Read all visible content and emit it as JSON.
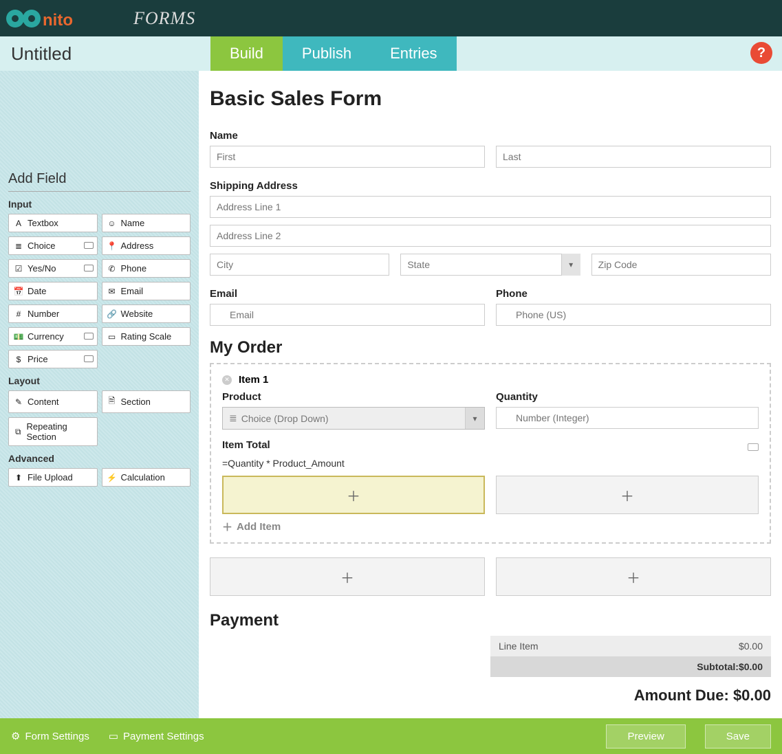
{
  "header": {
    "brand_text": "FORMS"
  },
  "nav": {
    "form_name": "Untitled",
    "tabs": {
      "build": "Build",
      "publish": "Publish",
      "entries": "Entries"
    },
    "help": "?"
  },
  "sidebar": {
    "title": "Add Field",
    "groups": {
      "input": {
        "label": "Input",
        "items": [
          {
            "label": "Textbox",
            "icon": "A"
          },
          {
            "label": "Name",
            "icon": "☺"
          },
          {
            "label": "Choice",
            "icon": "≣",
            "badge": true
          },
          {
            "label": "Address",
            "icon": "📍"
          },
          {
            "label": "Yes/No",
            "icon": "☑",
            "badge": true
          },
          {
            "label": "Phone",
            "icon": "✆"
          },
          {
            "label": "Date",
            "icon": "📅"
          },
          {
            "label": "Email",
            "icon": "✉"
          },
          {
            "label": "Number",
            "icon": "#"
          },
          {
            "label": "Website",
            "icon": "🔗"
          },
          {
            "label": "Currency",
            "icon": "💵",
            "badge": true
          },
          {
            "label": "Rating Scale",
            "icon": "▭"
          },
          {
            "label": "Price",
            "icon": "$",
            "badge": true
          }
        ]
      },
      "layout": {
        "label": "Layout",
        "items": [
          {
            "label": "Content",
            "icon": "✎"
          },
          {
            "label": "Section",
            "icon": "🗎"
          },
          {
            "label": "Repeating Section",
            "icon": "⧉"
          }
        ]
      },
      "advanced": {
        "label": "Advanced",
        "items": [
          {
            "label": "File Upload",
            "icon": "⬆"
          },
          {
            "label": "Calculation",
            "icon": "⚡"
          }
        ]
      }
    }
  },
  "form": {
    "title": "Basic Sales Form",
    "name": {
      "label": "Name",
      "first_ph": "First",
      "last_ph": "Last"
    },
    "shipping": {
      "label": "Shipping Address",
      "line1_ph": "Address Line 1",
      "line2_ph": "Address Line 2",
      "city_ph": "City",
      "state_ph": "State",
      "zip_ph": "Zip Code"
    },
    "email": {
      "label": "Email",
      "ph": "Email"
    },
    "phone": {
      "label": "Phone",
      "ph": "Phone (US)"
    },
    "order": {
      "heading": "My Order",
      "item_label": "Item 1",
      "product": {
        "label": "Product",
        "ph": "Choice (Drop Down)"
      },
      "quantity": {
        "label": "Quantity",
        "ph": "Number (Integer)"
      },
      "item_total": {
        "label": "Item Total",
        "formula": "=Quantity * Product_Amount"
      },
      "add_item": "Add Item"
    },
    "payment": {
      "heading": "Payment",
      "line_item_label": "Line Item",
      "line_item_value": "$0.00",
      "subtotal_label": "Subtotal:",
      "subtotal_value": "$0.00",
      "amount_due_label": "Amount Due:",
      "amount_due_value": "$0.00"
    }
  },
  "footer": {
    "form_settings": "Form Settings",
    "payment_settings": "Payment Settings",
    "preview": "Preview",
    "save": "Save"
  }
}
